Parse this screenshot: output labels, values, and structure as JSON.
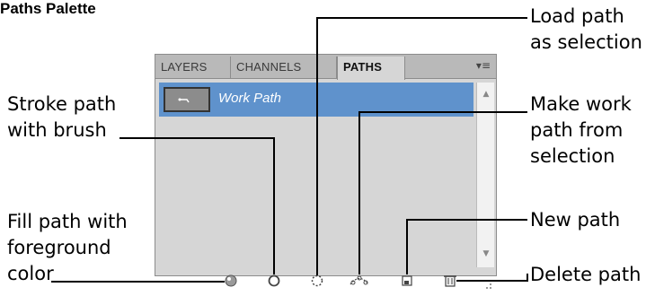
{
  "title": "Paths Palette",
  "palette": {
    "tabs": [
      "LAYERS",
      "CHANNELS",
      "PATHS"
    ],
    "active_tab": "PATHS",
    "menu_icon": "panel-menu-icon",
    "path_item": "Work Path"
  },
  "callouts": {
    "load_selection_1": "Load path",
    "load_selection_2": "as selection",
    "stroke_1": "Stroke path",
    "stroke_2": "with brush",
    "make_work_1": "Make work",
    "make_work_2": "path from",
    "make_work_3": "selection",
    "fill_1": "Fill path with",
    "fill_2": "foreground",
    "fill_3": "color",
    "new_path": "New path",
    "delete_path": "Delete path"
  },
  "icons": [
    "fill-path-icon",
    "stroke-path-icon",
    "load-selection-icon",
    "make-work-path-icon",
    "new-path-icon",
    "delete-path-icon"
  ]
}
